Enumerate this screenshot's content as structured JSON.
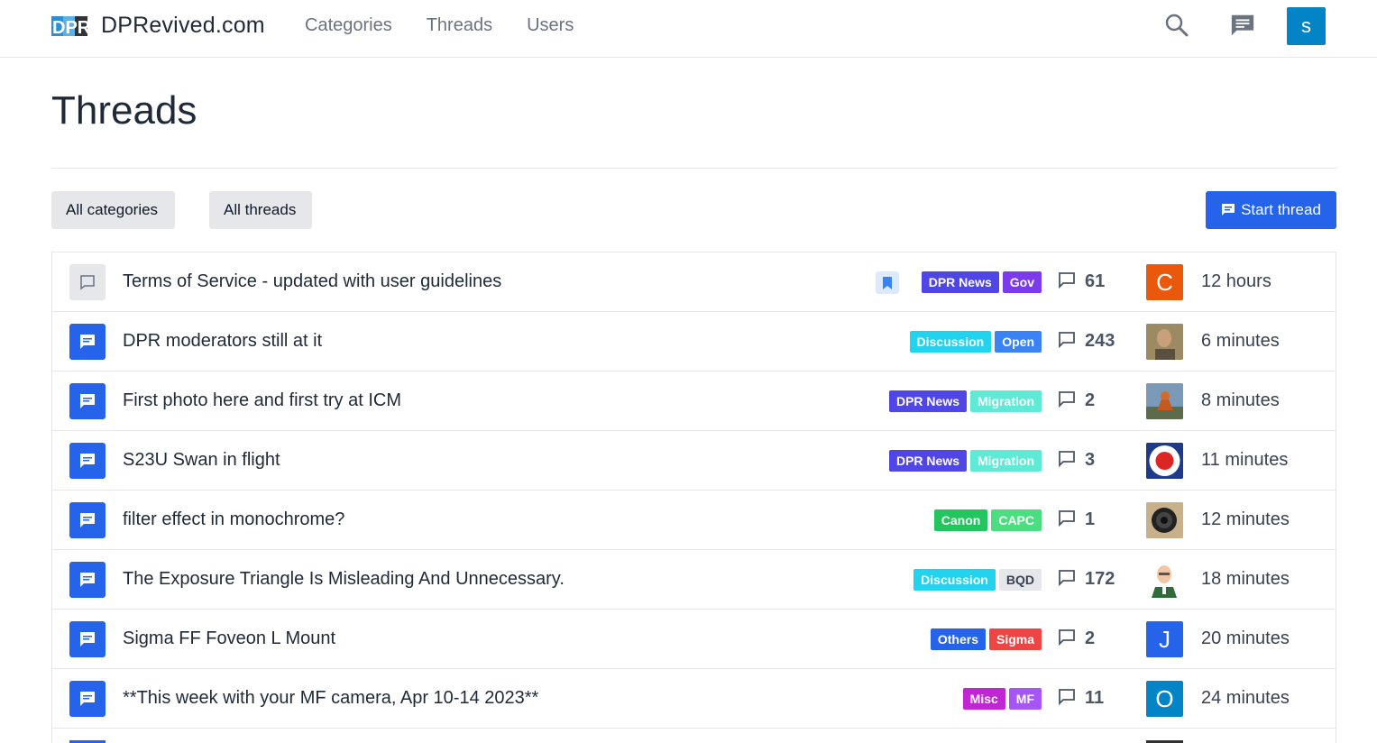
{
  "header": {
    "brand_logo_text": "DPR",
    "brand_name": "DPRevived.com",
    "nav": [
      "Categories",
      "Threads",
      "Users"
    ],
    "user_initial": "s"
  },
  "page": {
    "title": "Threads"
  },
  "filters": {
    "categories_label": "All categories",
    "threads_label": "All threads",
    "start_thread_label": "Start thread"
  },
  "threads": [
    {
      "title": "Terms of Service - updated with user guidelines",
      "tags": [
        {
          "text": "DPR News",
          "color": "#4f46e5"
        },
        {
          "text": "Gov",
          "color": "#7c3aed"
        }
      ],
      "replies": "61",
      "time": "12 hours",
      "avatar_letter": "C",
      "avatar_color": "#ea580c",
      "bookmarked": true,
      "read": true
    },
    {
      "title": "DPR moderators still at it",
      "tags": [
        {
          "text": "Discussion",
          "color": "#22d3ee"
        },
        {
          "text": "Open",
          "color": "#3b82f6"
        }
      ],
      "replies": "243",
      "time": "6 minutes",
      "avatar_letter": "",
      "avatar_color": "#8b7d5a",
      "bookmarked": false,
      "read": false
    },
    {
      "title": "First photo here and first try at ICM",
      "tags": [
        {
          "text": "DPR News",
          "color": "#4f46e5"
        },
        {
          "text": "Migration",
          "color": "#5eead4"
        }
      ],
      "replies": "2",
      "time": "8 minutes",
      "avatar_letter": "",
      "avatar_color": "#5b7a9a",
      "bookmarked": false,
      "read": false
    },
    {
      "title": "S23U Swan in flight",
      "tags": [
        {
          "text": "DPR News",
          "color": "#4f46e5"
        },
        {
          "text": "Migration",
          "color": "#5eead4"
        }
      ],
      "replies": "3",
      "time": "11 minutes",
      "avatar_letter": "",
      "avatar_color": "#1e3a8a",
      "bookmarked": false,
      "read": false
    },
    {
      "title": "filter effect in monochrome?",
      "tags": [
        {
          "text": "Canon",
          "color": "#22c55e"
        },
        {
          "text": "CAPC",
          "color": "#4ade80"
        }
      ],
      "replies": "1",
      "time": "12 minutes",
      "avatar_letter": "",
      "avatar_color": "#a08060",
      "bookmarked": false,
      "read": false
    },
    {
      "title": "The Exposure Triangle Is Misleading And Unnecessary.",
      "tags": [
        {
          "text": "Discussion",
          "color": "#22d3ee"
        },
        {
          "text": "BQD",
          "color": "#e5e7eb"
        }
      ],
      "replies": "172",
      "time": "18 minutes",
      "avatar_letter": "",
      "avatar_color": "#ffffff",
      "bookmarked": false,
      "read": false
    },
    {
      "title": "Sigma FF Foveon L Mount",
      "tags": [
        {
          "text": "Others",
          "color": "#2563eb"
        },
        {
          "text": "Sigma",
          "color": "#ef4444"
        }
      ],
      "replies": "2",
      "time": "20 minutes",
      "avatar_letter": "J",
      "avatar_color": "#2563eb",
      "bookmarked": false,
      "read": false
    },
    {
      "title": "**This week with your MF camera, Apr 10-14 2023**",
      "tags": [
        {
          "text": "Misc",
          "color": "#c026d3"
        },
        {
          "text": "MF",
          "color": "#a855f7"
        }
      ],
      "replies": "11",
      "time": "24 minutes",
      "avatar_letter": "O",
      "avatar_color": "#0284c7",
      "bookmarked": false,
      "read": false
    }
  ]
}
